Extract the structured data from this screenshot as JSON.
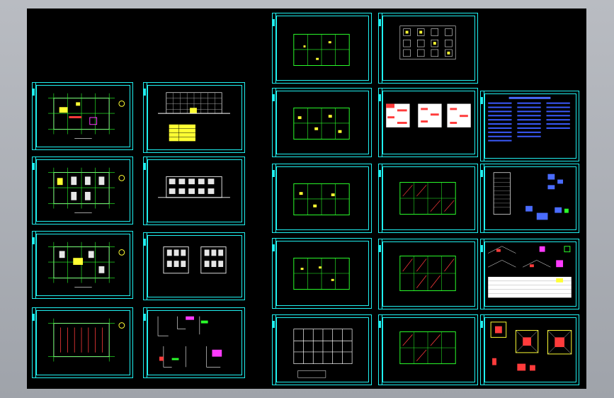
{
  "app": {
    "background": "#000000",
    "frame_color": "#1ff0f0"
  },
  "sheets": [
    {
      "id": "a1",
      "kind": "floorplan-1"
    },
    {
      "id": "a2",
      "kind": "floorplan-2"
    },
    {
      "id": "a3",
      "kind": "floorplan-3"
    },
    {
      "id": "a4",
      "kind": "roof-plan"
    },
    {
      "id": "b1",
      "kind": "elevation-front"
    },
    {
      "id": "b2",
      "kind": "elevation-rear"
    },
    {
      "id": "b3",
      "kind": "elevation-sides"
    },
    {
      "id": "b4",
      "kind": "details"
    },
    {
      "id": "c1",
      "kind": "beam-plan-1"
    },
    {
      "id": "c2",
      "kind": "beam-plan-2"
    },
    {
      "id": "c3",
      "kind": "beam-plan-3"
    },
    {
      "id": "c4",
      "kind": "beam-plan-4"
    },
    {
      "id": "c5",
      "kind": "column-grid"
    },
    {
      "id": "d1",
      "kind": "foundation-plan"
    },
    {
      "id": "d2",
      "kind": "tables"
    },
    {
      "id": "d3",
      "kind": "slab-plan-1"
    },
    {
      "id": "d4",
      "kind": "slab-plan-2"
    },
    {
      "id": "d5",
      "kind": "slab-plan-3"
    },
    {
      "id": "e1",
      "kind": "general-notes"
    },
    {
      "id": "e2",
      "kind": "stair-details"
    },
    {
      "id": "e3",
      "kind": "section-details"
    },
    {
      "id": "e4",
      "kind": "footing-details"
    }
  ]
}
